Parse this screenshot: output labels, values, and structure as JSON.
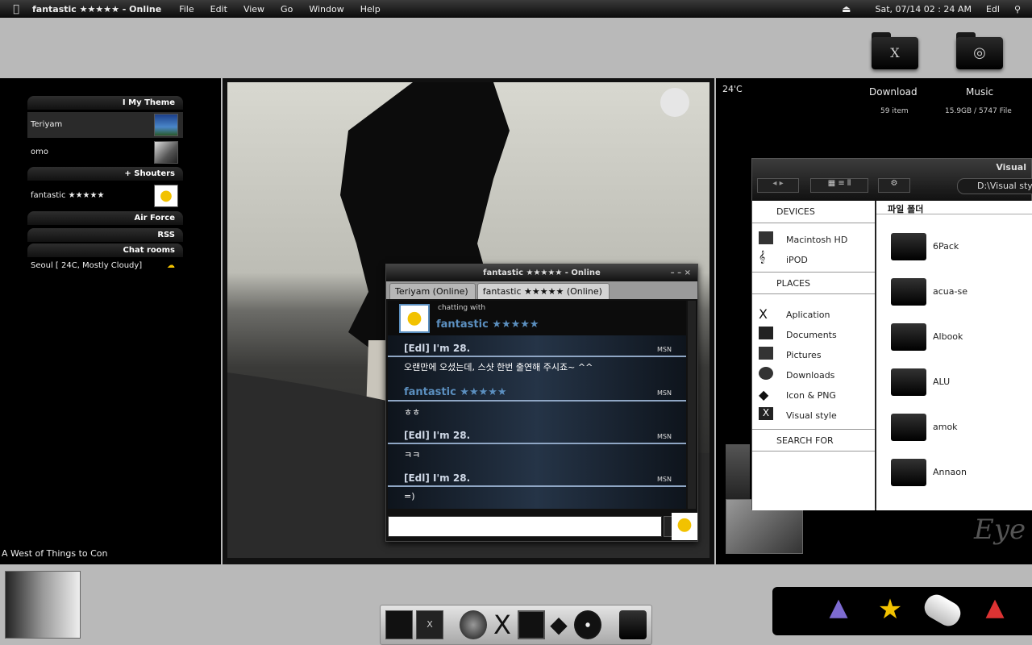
{
  "menubar": {
    "app_title": "fantastic ★★★★★ - Online",
    "items": [
      "File",
      "Edit",
      "View",
      "Go",
      "Window",
      "Help"
    ],
    "datetime": "Sat, 07/14  02 : 24 AM",
    "user": "Edl"
  },
  "desktop_folders": [
    {
      "label": "Download",
      "info": "59  item"
    },
    {
      "label": "Music",
      "info": "15.9GB / 5747 File"
    }
  ],
  "weather_temp": "24'C",
  "left_panel": {
    "my_theme_header": "I My Theme",
    "theme_items": [
      "Teriyam",
      "omo"
    ],
    "shouters_header": "+ Shouters",
    "shouter": "fantastic ★★★★★",
    "links": [
      "Air Force",
      "RSS"
    ],
    "chat_rooms_header": "Chat rooms",
    "weather": "Seoul  [ 24C, Mostly Cloudy]",
    "bottom_label": "A West of Things to Con"
  },
  "chat": {
    "title": "fantastic ★★★★★ - Online",
    "tabs": [
      "Teriyam (Online)",
      "fantastic ★★★★★ (Online)"
    ],
    "chatting_with_label": "chatting with",
    "chatting_with_name": "fantastic ★★★★★",
    "messages": [
      {
        "sender": "[Edl] I'm 28.",
        "proto": "MSN",
        "text": "오랜만에 오셨는데, 스샷 한번 출연해 주시죠~ ^^"
      },
      {
        "sender": "fantastic ★★★★★",
        "proto": "MSN",
        "text": "ㅎㅎ"
      },
      {
        "sender": "[Edl] I'm 28.",
        "proto": "MSN",
        "text": "ㅋㅋ"
      },
      {
        "sender": "[Edl] I'm 28.",
        "proto": "MSN",
        "text": "=)"
      }
    ]
  },
  "finder": {
    "title": "Visual",
    "path": "D:\\Visual sty",
    "devices_header": "DEVICES",
    "devices": [
      "Macintosh HD",
      "iPOD"
    ],
    "places_header": "PLACES",
    "places": [
      "Aplication",
      "Documents",
      "Pictures",
      "Downloads",
      "Icon & PNG",
      "Visual style"
    ],
    "search_header": "SEARCH FOR",
    "main_header": "파일 폴더",
    "files": [
      "6Pack",
      "acua-se",
      "Albook",
      "ALU",
      "amok",
      "Annaon"
    ]
  },
  "eye_text": "Eye",
  "colors": {
    "accent_blue": "#5b8fbf",
    "menubar": "#111111"
  }
}
